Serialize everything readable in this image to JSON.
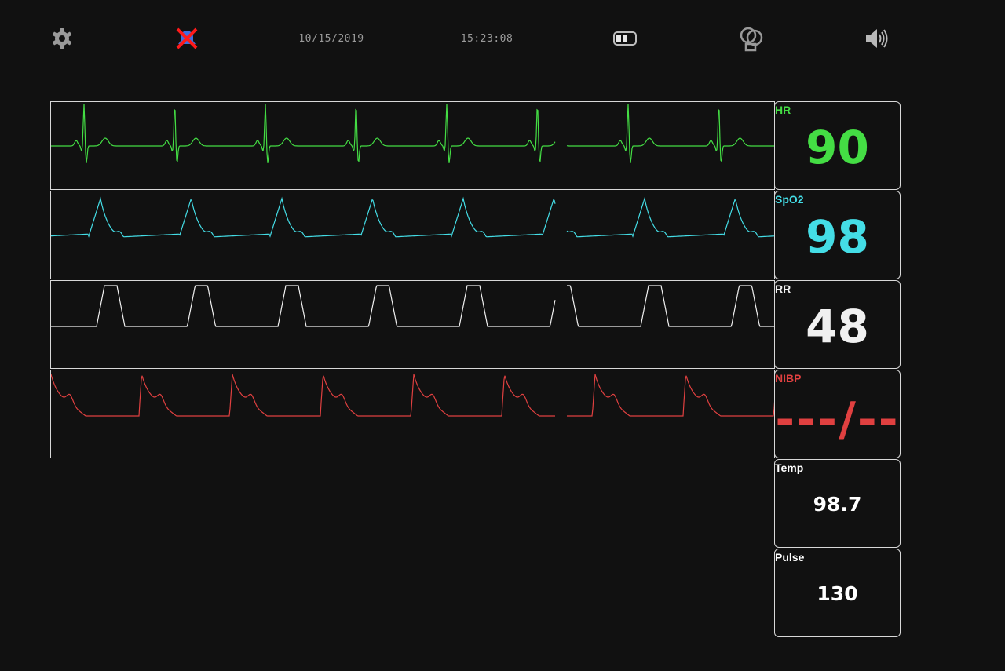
{
  "topbar": {
    "settings_icon": "gear-icon",
    "alarm_icon": "alarm-off-icon",
    "date": "10/15/2019",
    "time": "15:23:08",
    "battery_icon": "battery-icon",
    "display_icon": "monitor-icon",
    "volume_icon": "speaker-icon"
  },
  "colors": {
    "hr": "#44dd44",
    "spo2": "#44dde6",
    "rr": "#f0f0f0",
    "nibp": "#e04040",
    "temp": "#ffffff",
    "pulse": "#ffffff"
  },
  "vitals": {
    "hr": {
      "label": "HR",
      "value": "90"
    },
    "spo2": {
      "label": "SpO2",
      "value": "98"
    },
    "rr": {
      "label": "RR",
      "value": "48"
    },
    "nibp": {
      "label": "NIBP",
      "value": "---/--"
    },
    "temp": {
      "label": "Temp",
      "value": "98.7"
    },
    "pulse": {
      "label": "Pulse",
      "value": "130"
    }
  }
}
